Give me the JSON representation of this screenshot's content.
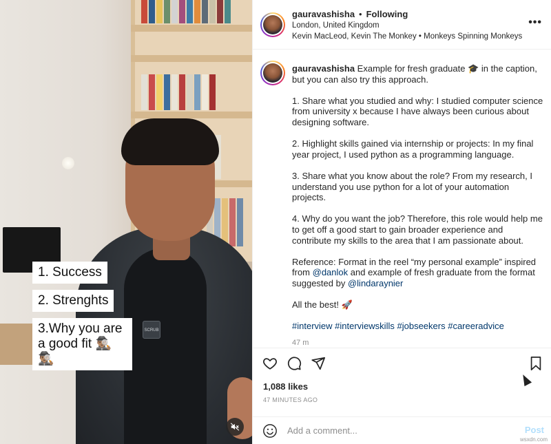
{
  "video": {
    "overlay_items": [
      "1. Success",
      "2. Strenghts",
      "3.Why you are\na good fit 🕵🏽‍♂️🕵🏽‍♂️"
    ],
    "badge_text": "SCRUB",
    "mute_icon": "speaker-muted-icon"
  },
  "header": {
    "username": "gauravashisha",
    "separator": "•",
    "follow_status": "Following",
    "location": "London, United Kingdom",
    "audio": "Kevin MacLeod, Kevin The Monkey • Monkeys Spinning Monkeys",
    "more_label": "•••"
  },
  "caption": {
    "username": "gauravashisha",
    "intro": "Example for fresh graduate 🎓 in the caption, but you can also try this approach.",
    "point1": "1. Share what you studied and why: I studied computer science from university x because I have always been curious about designing software.",
    "point2": "2. Highlight skills gained via internship or projects: In my final year project, I used python as a programming language.",
    "point3": "3. Share what you know about the role? From my research, I understand you use python for a lot of your automation projects.",
    "point4": "4. Why do you want the job? Therefore, this role would help me to get off a good start to gain broader experience and contribute my skills to the area that I am passionate about.",
    "reference_pre": "Reference: Format in the reel “my personal example” inspired from",
    "mention1": "@danlok",
    "reference_mid": "and example of fresh graduate from the format suggested by",
    "mention2": "@lindaraynier",
    "closing": "All the best! 🚀",
    "hashtags": [
      "#interview",
      "#interviewskills",
      "#jobseekers",
      "#careeradvice"
    ],
    "time_ago": "47 m"
  },
  "actions": {
    "likes": "1,088 likes",
    "timestamp": "47 MINUTES AGO"
  },
  "comment": {
    "placeholder": "Add a comment...",
    "post_label": "Post"
  },
  "watermark": "wsxdn.com",
  "colors": {
    "link": "#00376b",
    "muted": "#8e8e8e",
    "post_disabled": "#b2dffc"
  }
}
